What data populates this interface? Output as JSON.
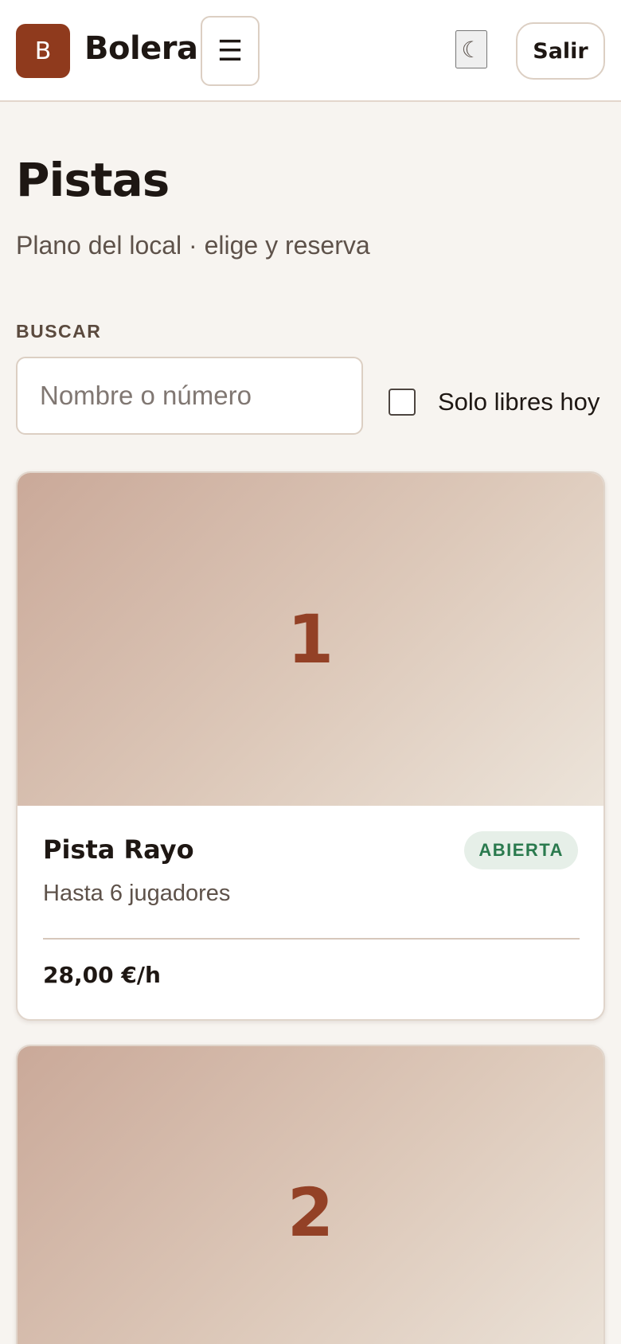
{
  "header": {
    "logo_letter": "B",
    "brand": "Bolera",
    "menu_icon": "☰",
    "theme_icon": "☾",
    "logout_label": "Salir"
  },
  "page": {
    "title": "Pistas",
    "subtitle": "Plano del local · elige y reserva"
  },
  "search": {
    "label": "BUSCAR",
    "value": "",
    "placeholder": "Nombre o número",
    "free_today_label": "Solo libres hoy",
    "free_today_checked": false
  },
  "lanes": [
    {
      "number": "1",
      "name": "Pista Rayo",
      "status": "ABIERTA",
      "capacity": "Hasta 6 jugadores",
      "price": "28,00 €/h"
    },
    {
      "number": "2"
    }
  ],
  "colors": {
    "brand": "#8f3a1d",
    "lane_number": "#934126",
    "status_open_bg": "#e6efe8",
    "status_open_text": "#2a7a4e",
    "page_bg": "#f7f4f0"
  }
}
